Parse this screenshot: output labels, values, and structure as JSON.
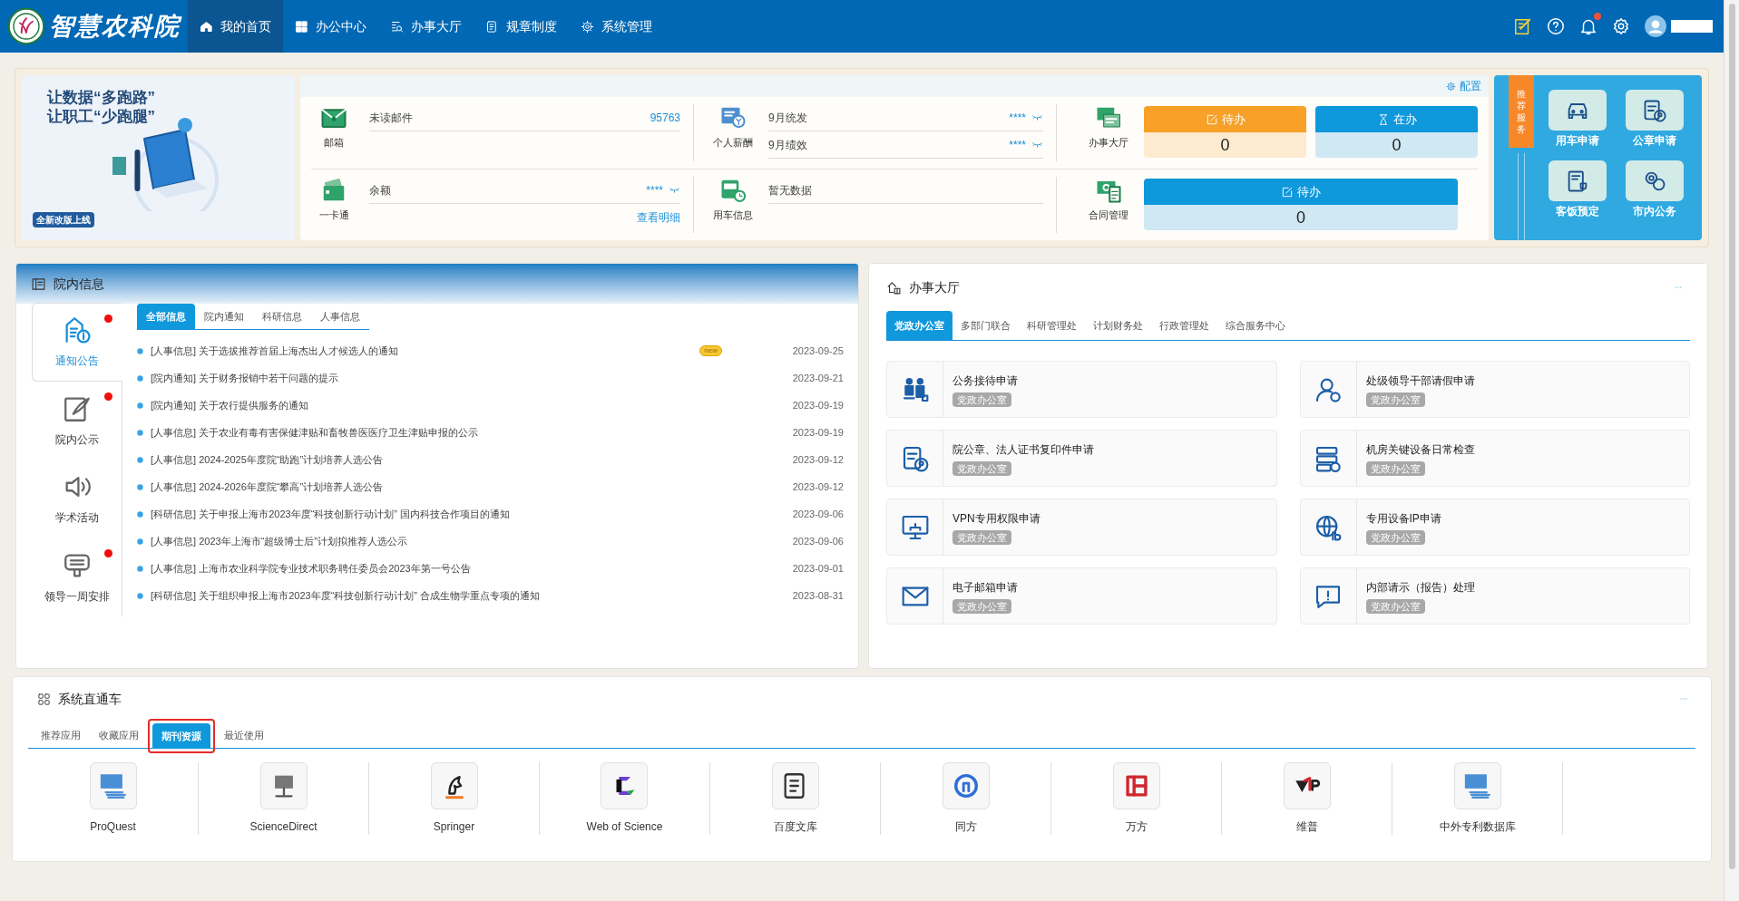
{
  "header": {
    "logo_text": "智慧农科院",
    "nav": [
      {
        "label": "我的首页",
        "selected": true
      },
      {
        "label": "办公中心",
        "selected": false
      },
      {
        "label": "办事大厅",
        "selected": false
      },
      {
        "label": "规章制度",
        "selected": false
      },
      {
        "label": "系统管理",
        "selected": false
      }
    ],
    "notifications_unread": true
  },
  "banner": {
    "slogan_lines": [
      "让数据“多跑路”",
      "让职工“少跑腿”"
    ],
    "badge": "全新改版上线"
  },
  "summary": {
    "config_link": "配置",
    "mail": {
      "label": "邮箱",
      "row_label": "未读邮件",
      "value": "95763"
    },
    "salary": {
      "label": "个人薪酬",
      "rows": [
        {
          "label": "9月统发",
          "value": "****"
        },
        {
          "label": "9月绩效",
          "value": "****"
        }
      ]
    },
    "card": {
      "label": "一卡通",
      "row_label": "余额",
      "value": "****",
      "link": "查看明细"
    },
    "car": {
      "label": "用车信息",
      "row_label": "暂无数据"
    },
    "hall": {
      "label": "办事大厅",
      "tiles": [
        {
          "kind": "todo",
          "label": "待办",
          "count": "0",
          "color": "#f7a128"
        },
        {
          "kind": "doing",
          "label": "在办",
          "count": "0",
          "color": "#0f98dc"
        }
      ]
    },
    "contract": {
      "label": "合同管理",
      "tiles": [
        {
          "kind": "todo",
          "label": "待办",
          "count": "0",
          "color": "#0f98dc"
        }
      ]
    }
  },
  "recommended": {
    "ribbon": "推荐服务",
    "items": [
      {
        "label": "用车申请"
      },
      {
        "label": "公章申请"
      },
      {
        "label": "客饭预定"
      },
      {
        "label": "市内公务"
      }
    ]
  },
  "info": {
    "title": "院内信息",
    "side": [
      {
        "label": "通知公告",
        "selected": true,
        "unread": true
      },
      {
        "label": "院内公示",
        "selected": false,
        "unread": true
      },
      {
        "label": "学术活动",
        "selected": false,
        "unread": false
      },
      {
        "label": "领导一周安排",
        "selected": false,
        "unread": true
      }
    ],
    "tabs": [
      {
        "label": "全部信息",
        "selected": true
      },
      {
        "label": "院内通知",
        "selected": false
      },
      {
        "label": "科研信息",
        "selected": false
      },
      {
        "label": "人事信息",
        "selected": false
      }
    ],
    "news": [
      {
        "title": "[人事信息] 关于选拔推荐首届上海杰出人才候选人的通知",
        "date": "2023-09-25",
        "new": true
      },
      {
        "title": "[院内通知] 关于财务报销中若干问题的提示",
        "date": "2023-09-21",
        "new": false
      },
      {
        "title": "[院内通知] 关于农行提供服务的通知",
        "date": "2023-09-19",
        "new": false
      },
      {
        "title": "[人事信息] 关于农业有毒有害保健津贴和畜牧兽医医疗卫生津贴申报的公示",
        "date": "2023-09-19",
        "new": false
      },
      {
        "title": "[人事信息] 2024-2025年度院“助跑”计划培养人选公告",
        "date": "2023-09-12",
        "new": false
      },
      {
        "title": "[人事信息] 2024-2026年度院“攀高”计划培养人选公告",
        "date": "2023-09-12",
        "new": false
      },
      {
        "title": "[科研信息] 关于申报上海市2023年度“科技创新行动计划” 国内科技合作项目的通知",
        "date": "2023-09-06",
        "new": false
      },
      {
        "title": "[人事信息] 2023年上海市“超级博士后”计划拟推荐人选公示",
        "date": "2023-09-06",
        "new": false
      },
      {
        "title": "[人事信息] 上海市农业科学院专业技术职务聘任委员会2023年第一号公告",
        "date": "2023-09-01",
        "new": false
      },
      {
        "title": "[科研信息] 关于组织申报上海市2023年度“科技创新行动计划” 合成生物学重点专项的通知",
        "date": "2023-08-31",
        "new": false
      }
    ],
    "new_badge": "new"
  },
  "hall_panel": {
    "title": "办事大厅",
    "tabs": [
      {
        "label": "党政办公室",
        "selected": true
      },
      {
        "label": "多部门联合",
        "selected": false
      },
      {
        "label": "科研管理处",
        "selected": false
      },
      {
        "label": "计划财务处",
        "selected": false
      },
      {
        "label": "行政管理处",
        "selected": false
      },
      {
        "label": "综合服务中心",
        "selected": false
      }
    ],
    "services": [
      {
        "title": "公务接待申请",
        "dept": "党政办公室"
      },
      {
        "title": "处级领导干部请假申请",
        "dept": "党政办公室"
      },
      {
        "title": "院公章、法人证书复印件申请",
        "dept": "党政办公室"
      },
      {
        "title": "机房关键设备日常检查",
        "dept": "党政办公室"
      },
      {
        "title": "VPN专用权限申请",
        "dept": "党政办公室"
      },
      {
        "title": "专用设备IP申请",
        "dept": "党政办公室"
      },
      {
        "title": "电子邮箱申请",
        "dept": "党政办公室"
      },
      {
        "title": "内部请示（报告）处理",
        "dept": "党政办公室"
      }
    ]
  },
  "shortcuts": {
    "title": "系统直通车",
    "tabs": [
      {
        "label": "推荐应用",
        "selected": false,
        "highlighted": false
      },
      {
        "label": "收藏应用",
        "selected": false,
        "highlighted": false
      },
      {
        "label": "期刊资源",
        "selected": true,
        "highlighted": true
      },
      {
        "label": "最近使用",
        "selected": false,
        "highlighted": false
      }
    ],
    "resources": [
      {
        "name": "ProQuest"
      },
      {
        "name": "ScienceDirect"
      },
      {
        "name": "Springer"
      },
      {
        "name": "Web of Science"
      },
      {
        "name": "百度文库"
      },
      {
        "name": "同方"
      },
      {
        "name": "万方"
      },
      {
        "name": "维普"
      },
      {
        "name": "中外专利数据库"
      }
    ]
  }
}
